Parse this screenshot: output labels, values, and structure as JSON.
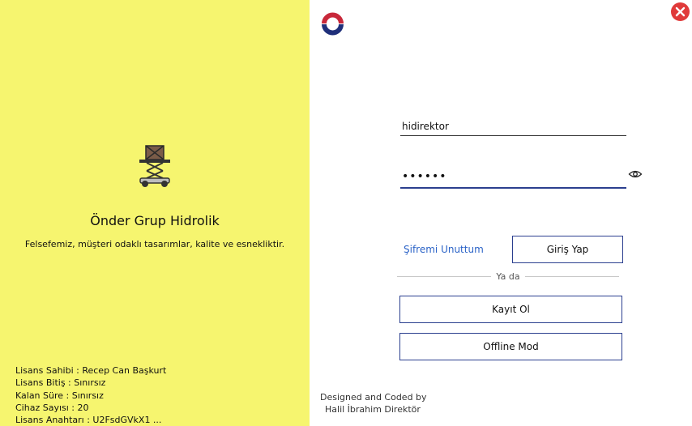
{
  "left_panel": {
    "company_name": "Önder Grup Hidrolik",
    "slogan": "Felsefemiz, müşteri odaklı tasarımlar, kalite ve esnekliktir.",
    "license": {
      "owner": "Lisans Sahibi : Recep Can Başkurt",
      "end": "Lisans Bitiş : Sınırsız",
      "remaining": "Kalan Süre : Sınırsız",
      "devices": "Cihaz Sayısı : 20",
      "key": "Lisans Anahtarı : U2FsdGVkX1 ..."
    },
    "background_color": "#f6f56f"
  },
  "login_form": {
    "username_value": "hidirektor",
    "password_value": "••••••",
    "forgot_password": "Şifremi Unuttum",
    "login_button": "Giriş Yap",
    "or_text": "Ya da",
    "register_button": "Kayıt Ol",
    "offline_button": "Offline Mod",
    "accent_color": "#2b3f8f",
    "link_color": "#2b63c7"
  },
  "footer": {
    "line1": "Designed and Coded by",
    "line2": "Halil İbrahim Direktör"
  },
  "icons": {
    "close": "close-icon",
    "eye": "eye-icon",
    "brand": "brand-logo",
    "lift": "scissor-lift-icon"
  }
}
